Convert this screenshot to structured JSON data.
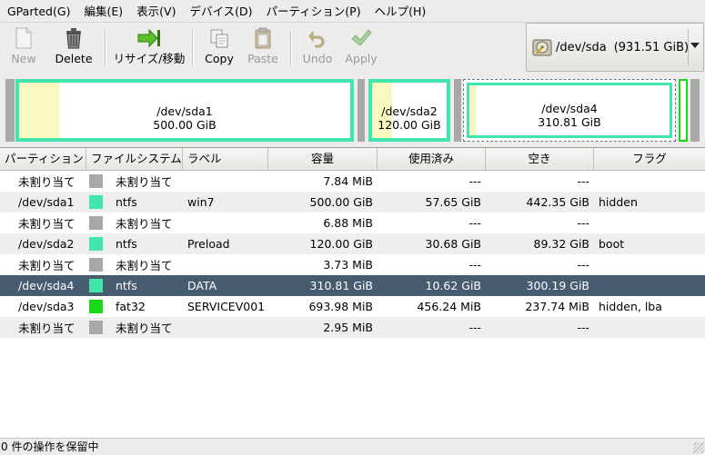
{
  "menubar": {
    "items": [
      {
        "label": "GParted(",
        "acc": "G",
        "end": ")"
      },
      {
        "label": "編集(",
        "acc": "E",
        "end": ")"
      },
      {
        "label": "表示(",
        "acc": "V",
        "end": ")"
      },
      {
        "label": "デバイス(",
        "acc": "D",
        "end": ")"
      },
      {
        "label": "パーティション(",
        "acc": "P",
        "end": ")"
      },
      {
        "label": "ヘルプ(",
        "acc": "H",
        "end": ")"
      }
    ]
  },
  "toolbar": {
    "new": "New",
    "delete": "Delete",
    "resize": "リサイズ/移動",
    "copy": "Copy",
    "paste": "Paste",
    "undo": "Undo",
    "apply": "Apply"
  },
  "device": {
    "path": "/dev/sda",
    "size": "(931.51 GiB)"
  },
  "graph": {
    "sda1": {
      "name": "/dev/sda1",
      "size": "500.00 GiB"
    },
    "sda2": {
      "name": "/dev/sda2",
      "size": "120.00 GiB"
    },
    "sda4": {
      "name": "/dev/sda4",
      "size": "310.81 GiB"
    }
  },
  "columns": [
    "パーティション",
    "ファイルシステム",
    "ラベル",
    "容量",
    "使用済み",
    "空き",
    "フラグ"
  ],
  "colors": {
    "ntfs": "#42e5ac",
    "fat32": "#18d918",
    "unallocated": "#a8a8a8",
    "selected_row": "#475c70"
  },
  "rows": [
    {
      "partition": "未割り当て",
      "fs": "未割り当て",
      "fs_color": "#a8a8a8",
      "label": "",
      "size": "7.84 MiB",
      "used": "---",
      "free": "---",
      "flags": ""
    },
    {
      "partition": "/dev/sda1",
      "fs": "ntfs",
      "fs_color": "#42e5ac",
      "label": "win7",
      "size": "500.00 GiB",
      "used": "57.65 GiB",
      "free": "442.35 GiB",
      "flags": "hidden"
    },
    {
      "partition": "未割り当て",
      "fs": "未割り当て",
      "fs_color": "#a8a8a8",
      "label": "",
      "size": "6.88 MiB",
      "used": "---",
      "free": "---",
      "flags": ""
    },
    {
      "partition": "/dev/sda2",
      "fs": "ntfs",
      "fs_color": "#42e5ac",
      "label": "Preload",
      "size": "120.00 GiB",
      "used": "30.68 GiB",
      "free": "89.32 GiB",
      "flags": "boot"
    },
    {
      "partition": "未割り当て",
      "fs": "未割り当て",
      "fs_color": "#a8a8a8",
      "label": "",
      "size": "3.73 MiB",
      "used": "---",
      "free": "---",
      "flags": ""
    },
    {
      "partition": "/dev/sda4",
      "fs": "ntfs",
      "fs_color": "#42e5ac",
      "label": "DATA",
      "size": "310.81 GiB",
      "used": "10.62 GiB",
      "free": "300.19 GiB",
      "flags": "",
      "selected": true
    },
    {
      "partition": "/dev/sda3",
      "fs": "fat32",
      "fs_color": "#18d918",
      "label": "SERVICEV001",
      "size": "693.98 MiB",
      "used": "456.24 MiB",
      "free": "237.74 MiB",
      "flags": "hidden, lba"
    },
    {
      "partition": "未割り当て",
      "fs": "未割り当て",
      "fs_color": "#a8a8a8",
      "label": "",
      "size": "2.95 MiB",
      "used": "---",
      "free": "---",
      "flags": ""
    }
  ],
  "status": "0 件の操作を保留中"
}
